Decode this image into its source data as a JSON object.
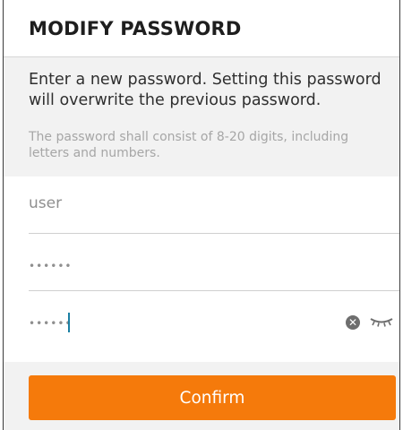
{
  "dialog": {
    "title": "MODIFY PASSWORD",
    "description": "Enter a new password. Setting this password will overwrite the previous password.",
    "hint": "The password shall consist of 8-20 digits, including letters and numbers."
  },
  "form": {
    "username_value": "user",
    "old_password_value": "••••••",
    "new_password_value": "••••••",
    "clear_icon": "clear-circle-icon",
    "visibility_icon": "eye-closed-icon"
  },
  "actions": {
    "confirm_label": "Confirm",
    "confirm_color": "#f57a0b"
  }
}
